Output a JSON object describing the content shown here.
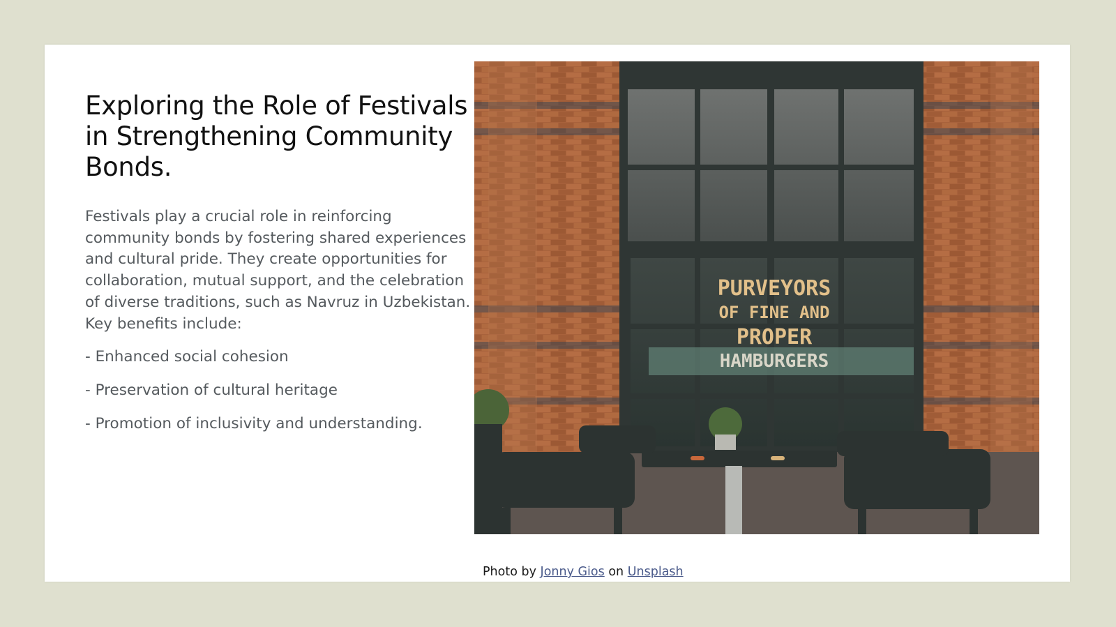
{
  "slide": {
    "title": "Exploring the Role of Festivals in Strengthening Community Bonds.",
    "paragraphs": [
      "Festivals play a crucial role in reinforcing community bonds by fostering shared experiences and cultural pride. They create opportunities for collaboration, mutual support, and the celebration of diverse traditions, such as Navruz in Uzbekistan. Key benefits include:",
      "- Enhanced social cohesion",
      "- Preservation of cultural heritage",
      "- Promotion of inclusivity and understanding."
    ]
  },
  "photo": {
    "sign_lines": [
      "PURVEYORS",
      "OF FINE AND",
      "PROPER",
      "HAMBURGERS"
    ]
  },
  "credit": {
    "prefix": "Photo by",
    "author": "Jonny Gios",
    "middle": "on",
    "source": "Unsplash"
  },
  "colors": {
    "background": "#dfe0cf",
    "slide": "#ffffff",
    "title_text": "#111111",
    "body_text": "#555a5e",
    "link": "#4a5a8a",
    "brick": "#a8623c",
    "window_frame": "#2f3634"
  }
}
